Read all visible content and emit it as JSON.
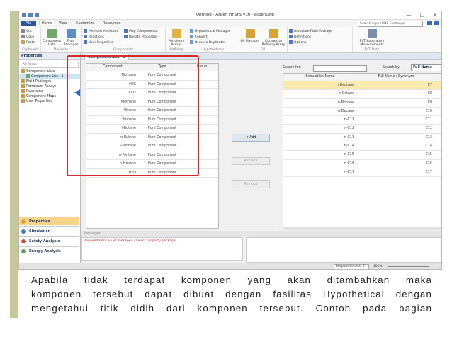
{
  "window": {
    "title": "Untitled - Aspen HYSYS V10 - aspenONE",
    "controls": [
      "—",
      "□",
      "×"
    ]
  },
  "ribbon_tabs": [
    "File",
    "Home",
    "View",
    "Customize",
    "Resources"
  ],
  "ribbon_search_placeholder": "Search aspenONE Exchange",
  "ribbon": {
    "clipboard": {
      "items": [
        "Cut",
        "Copy",
        "Paste"
      ],
      "label": "Clipboard"
    },
    "navigate": {
      "buttons": [
        "Component Lists",
        "Fluid Packages"
      ],
      "label": "Navigate"
    },
    "components_group": {
      "items": [
        "Methods Assistant",
        "Reactions",
        "User Properties",
        "Map Components",
        "Update Properties"
      ],
      "label": "Components"
    },
    "refining": {
      "button": "Petroleum Assays",
      "label": "Refining"
    },
    "hypothetical": {
      "items": [
        "Hypothetical Manager",
        "Convert",
        "Remove Duplicates"
      ],
      "label": "Hypotheticals"
    },
    "oil": {
      "buttons": [
        "Oil Manager",
        "Convert to Refining Assay"
      ],
      "label": "Oil"
    },
    "fluid_pkg": {
      "items": [
        "Associate Fluid Package",
        "Definitions",
        "Options"
      ]
    },
    "pvt": {
      "button": "PVT Laboratory Measurements",
      "label": "PVT Data"
    }
  },
  "properties_panel": {
    "title": "Properties",
    "filter": "All Items",
    "tree": [
      "Component Lists",
      "Component List - 1",
      "Fluid Packages",
      "Petroleum Assays",
      "Reactions",
      "Component Maps",
      "User Properties"
    ],
    "nav": [
      "Properties",
      "Simulation",
      "Safety Analysis",
      "Energy Analysis"
    ]
  },
  "document_tab": "Component List - 1",
  "component_table": {
    "headers": [
      "Component",
      "Type",
      "Group"
    ],
    "rows": [
      [
        "Nitrogen",
        "Pure Component",
        ""
      ],
      [
        "H2S",
        "Pure Component",
        ""
      ],
      [
        "CO2",
        "Pure Component",
        ""
      ],
      [
        "Methane",
        "Pure Component",
        ""
      ],
      [
        "Ethane",
        "Pure Component",
        ""
      ],
      [
        "Propane",
        "Pure Component",
        ""
      ],
      [
        "i-Butane",
        "Pure Component",
        ""
      ],
      [
        "n-Butane",
        "Pure Component",
        ""
      ],
      [
        "i-Pentane",
        "Pure Component",
        ""
      ],
      [
        "n-Pentane",
        "Pure Component",
        ""
      ],
      [
        "n-Hexane",
        "Pure Component",
        ""
      ],
      [
        "H2O",
        "Pure Component",
        ""
      ]
    ]
  },
  "buttons": {
    "add": "< Add",
    "replace": "Replace",
    "remove": "Remove"
  },
  "search": {
    "label": "Search for:",
    "by_label": "Search by:",
    "by_value": "Full Name"
  },
  "sim_table": {
    "headers": [
      "Simulation Name",
      "Full Name / Synonym"
    ],
    "rows": [
      [
        "n-Heptane",
        "C7"
      ],
      [
        "n-Octane",
        "C8"
      ],
      [
        "n-Nonane",
        "C9"
      ],
      [
        "n-Decane",
        "C10"
      ],
      [
        "n-C11",
        "C11"
      ],
      [
        "n-C12",
        "C12"
      ],
      [
        "n-C13",
        "C13"
      ],
      [
        "n-C14",
        "C14"
      ],
      [
        "n-C15",
        "C15"
      ],
      [
        "n-C16",
        "C16"
      ],
      [
        "n-C17",
        "C17"
      ]
    ]
  },
  "messages": {
    "title": "Messages",
    "text": "Required Info : Fluid Packages  -  Select property package"
  },
  "status": {
    "responsiveness": "Responsiveness: 5",
    "zoom": "100%"
  },
  "caption": [
    "Apabila tidak terdapat komponen yang akan ditambahkan maka",
    "komponen tersebut dapat dibuat dengan fasilitas Hypothetical dengan",
    "mengetahui titik didih dari komponen tersebut. Contoh pada bagian"
  ],
  "colors": {
    "accent": "#2b579a",
    "highlight_box": "#d62a2a",
    "sidebar_bar": "#c7c89a",
    "selected_row": "#fbeab0"
  }
}
